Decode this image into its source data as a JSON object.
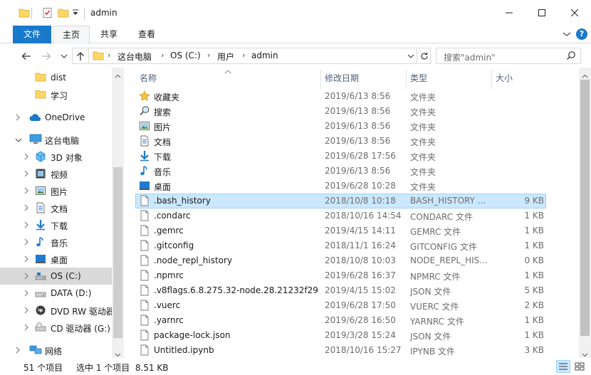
{
  "window": {
    "title": "admin",
    "minimize_glyph": "—",
    "maximize_glyph": "☐",
    "close_glyph": "✕"
  },
  "ribbon": {
    "tabs": [
      {
        "label": "文件"
      },
      {
        "label": "主页"
      },
      {
        "label": "共享"
      },
      {
        "label": "查看"
      }
    ],
    "help_glyph": "?"
  },
  "address": {
    "crumbs": [
      "这台电脑",
      "OS (C:)",
      "用户",
      "admin"
    ]
  },
  "search": {
    "placeholder": "搜索\"admin\""
  },
  "sidebar": {
    "items": [
      {
        "label": "dist",
        "icon": "folder-icon"
      },
      {
        "label": "学习",
        "icon": "folder-icon"
      },
      {
        "label": "OneDrive",
        "icon": "cloud-icon"
      },
      {
        "label": "这台电脑",
        "icon": "computer-icon"
      },
      {
        "label": "3D 对象",
        "icon": "3d-objects-icon"
      },
      {
        "label": "视频",
        "icon": "video-icon"
      },
      {
        "label": "图片",
        "icon": "pictures-icon"
      },
      {
        "label": "文档",
        "icon": "documents-icon"
      },
      {
        "label": "下载",
        "icon": "download-icon"
      },
      {
        "label": "音乐",
        "icon": "music-icon"
      },
      {
        "label": "桌面",
        "icon": "desktop-icon"
      },
      {
        "label": "OS (C:)",
        "icon": "drive-icon"
      },
      {
        "label": "DATA (D:)",
        "icon": "drive-icon"
      },
      {
        "label": "DVD RW 驱动器",
        "icon": "dvd-icon"
      },
      {
        "label": "CD 驱动器 (G:)",
        "icon": "cd-icon"
      },
      {
        "label": "网络",
        "icon": "network-icon"
      }
    ]
  },
  "columns": {
    "name": "名称",
    "date": "修改日期",
    "type": "类型",
    "size": "大小"
  },
  "files": [
    {
      "name": "收藏夹",
      "date": "2019/6/13 8:56",
      "type": "文件夹",
      "size": "",
      "icon": "favorites-icon"
    },
    {
      "name": "搜索",
      "date": "2019/6/13 8:56",
      "type": "文件夹",
      "size": "",
      "icon": "search-folder-icon"
    },
    {
      "name": "图片",
      "date": "2019/6/13 8:56",
      "type": "文件夹",
      "size": "",
      "icon": "pictures-icon"
    },
    {
      "name": "文档",
      "date": "2019/6/13 8:56",
      "type": "文件夹",
      "size": "",
      "icon": "documents-icon"
    },
    {
      "name": "下载",
      "date": "2019/6/28 17:56",
      "type": "文件夹",
      "size": "",
      "icon": "download-icon"
    },
    {
      "name": "音乐",
      "date": "2019/6/13 8:56",
      "type": "文件夹",
      "size": "",
      "icon": "music-icon"
    },
    {
      "name": "桌面",
      "date": "2019/6/28 10:28",
      "type": "文件夹",
      "size": "",
      "icon": "desktop-icon"
    },
    {
      "name": ".bash_history",
      "date": "2018/10/8 10:18",
      "type": "BASH_HISTORY ...",
      "size": "9 KB",
      "icon": "file-icon"
    },
    {
      "name": ".condarc",
      "date": "2018/10/16 14:54",
      "type": "CONDARC 文件",
      "size": "1 KB",
      "icon": "file-icon"
    },
    {
      "name": ".gemrc",
      "date": "2019/4/15 14:11",
      "type": "GEMRC 文件",
      "size": "1 KB",
      "icon": "file-icon"
    },
    {
      "name": ".gitconfig",
      "date": "2018/11/1 16:24",
      "type": "GITCONFIG 文件",
      "size": "1 KB",
      "icon": "file-icon"
    },
    {
      "name": ".node_repl_history",
      "date": "2018/10/8 10:03",
      "type": "NODE_REPL_HIS...",
      "size": "0 KB",
      "icon": "file-icon"
    },
    {
      "name": ".npmrc",
      "date": "2019/6/28 16:37",
      "type": "NPMRC 文件",
      "size": "1 KB",
      "icon": "file-icon"
    },
    {
      "name": ".v8flags.6.8.275.32-node.28.21232f29...",
      "date": "2019/4/15 15:02",
      "type": "JSON 文件",
      "size": "5 KB",
      "icon": "file-icon"
    },
    {
      "name": ".vuerc",
      "date": "2019/6/28 17:50",
      "type": "VUERC 文件",
      "size": "2 KB",
      "icon": "file-icon"
    },
    {
      "name": ".yarnrc",
      "date": "2019/6/28 16:50",
      "type": "YARNRC 文件",
      "size": "1 KB",
      "icon": "file-icon"
    },
    {
      "name": "package-lock.json",
      "date": "2019/3/28 15:24",
      "type": "JSON 文件",
      "size": "1 KB",
      "icon": "file-icon"
    },
    {
      "name": "Untitled.ipynb",
      "date": "2018/10/16 15:27",
      "type": "IPYNB 文件",
      "size": "3 KB",
      "icon": "file-icon"
    }
  ],
  "status": {
    "count": "51 个项目",
    "selection": "选中 1 个项目  8.51 KB"
  },
  "colors": {
    "accent": "#1979ca",
    "selected_row": "#cce8ff",
    "selected_border": "#99d1ff"
  }
}
